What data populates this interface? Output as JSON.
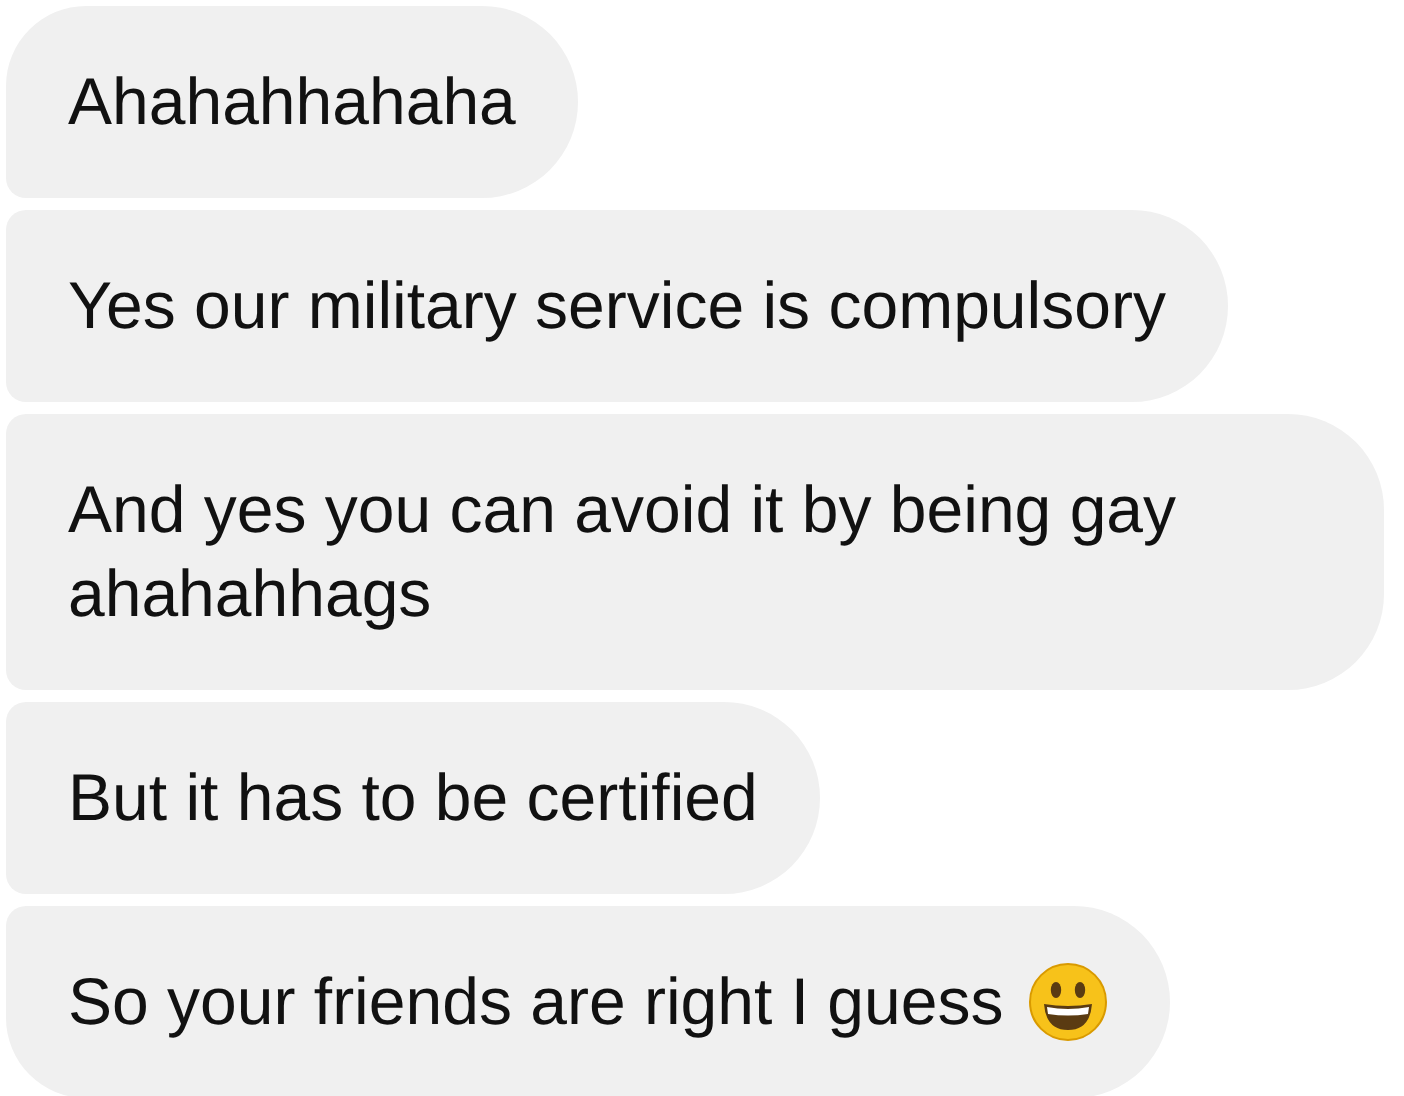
{
  "messages": [
    {
      "text": "Ahahahhahaha",
      "has_emoji": false
    },
    {
      "text": "Yes our military service is compulsory",
      "has_emoji": false
    },
    {
      "text": "And yes you can avoid it by being gay ahahahhags",
      "has_emoji": false
    },
    {
      "text": "But it has to be certified",
      "has_emoji": false
    },
    {
      "text": "So your friends are right I guess",
      "has_emoji": true
    }
  ]
}
